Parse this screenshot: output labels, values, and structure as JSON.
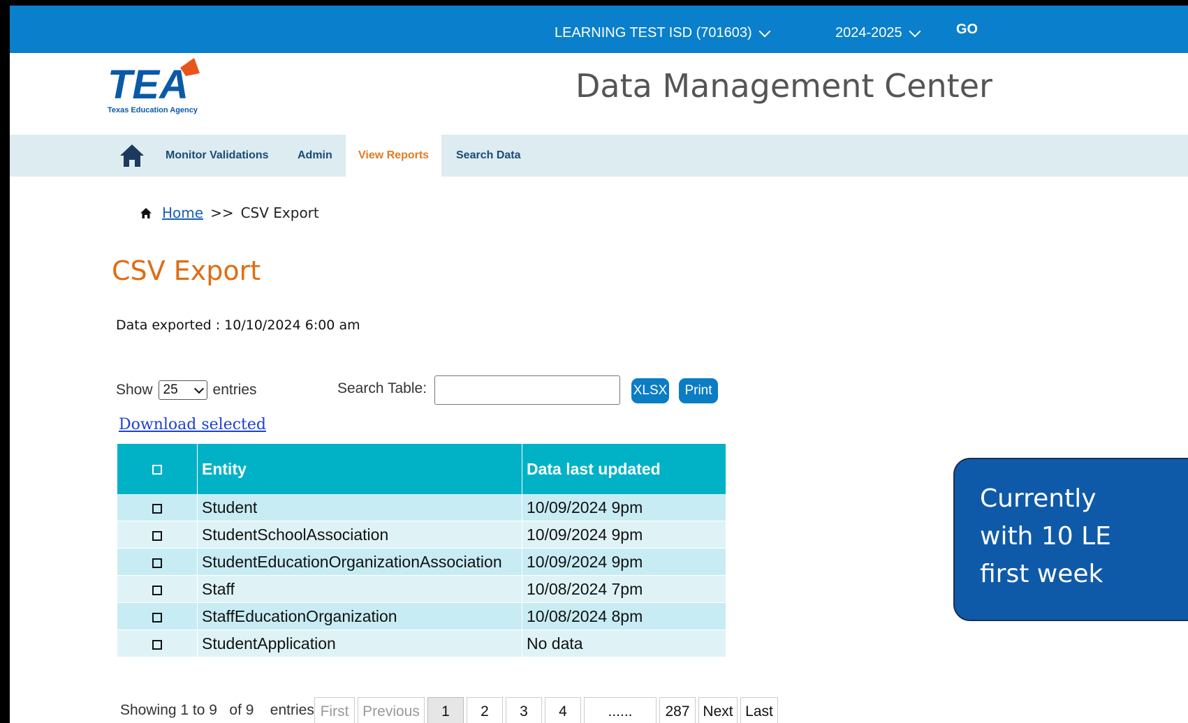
{
  "topbar": {
    "district": "LEARNING TEST ISD (701603)",
    "year": "2024-2025",
    "go": "GO"
  },
  "header": {
    "title": "Data Management Center",
    "logo_text": "TEA",
    "logo_subtitle": "Texas Education Agency"
  },
  "nav": {
    "items": [
      {
        "label": "Monitor Validations"
      },
      {
        "label": "Admin"
      },
      {
        "label": "View Reports"
      },
      {
        "label": "Search Data"
      }
    ]
  },
  "breadcrumb": {
    "home": "Home",
    "separator": ">>",
    "current": "CSV Export"
  },
  "page": {
    "title": "CSV Export",
    "exported": "Data exported : 10/10/2024 6:00 am"
  },
  "controls": {
    "show_label": "Show",
    "entries_value": "25",
    "entries_label": "entries",
    "search_label": "Search Table:",
    "search_value": "",
    "xlsx": "XLSX",
    "print": "Print",
    "download_selected": "Download selected"
  },
  "table": {
    "headers": [
      "Entity",
      "Data last updated"
    ],
    "rows": [
      {
        "entity": "Student",
        "updated": "10/09/2024 9pm"
      },
      {
        "entity": "StudentSchoolAssociation",
        "updated": "10/09/2024 9pm"
      },
      {
        "entity": "StudentEducationOrganizationAssociation",
        "updated": "10/09/2024 9pm"
      },
      {
        "entity": "Staff",
        "updated": "10/08/2024 7pm"
      },
      {
        "entity": "StaffEducationOrganization",
        "updated": "10/08/2024 8pm"
      },
      {
        "entity": "StudentApplication",
        "updated": "No data"
      }
    ]
  },
  "footer": {
    "info": "Showing 1 to 9   of 9    entries",
    "pagination": {
      "first": "First",
      "previous": "Previous",
      "pages": [
        "1",
        "2",
        "3",
        "4"
      ],
      "ellipsis": "......",
      "last_page": "287",
      "next": "Next",
      "last": "Last"
    }
  },
  "callout": {
    "lines": [
      "Currently",
      "with 10 LE",
      "first week"
    ]
  },
  "colors": {
    "topbar": "#0a7fcb",
    "nav_bg": "#dcecf1",
    "accent_orange": "#e06c12",
    "table_header": "#01b2c6",
    "callout": "#0f5aa8"
  }
}
